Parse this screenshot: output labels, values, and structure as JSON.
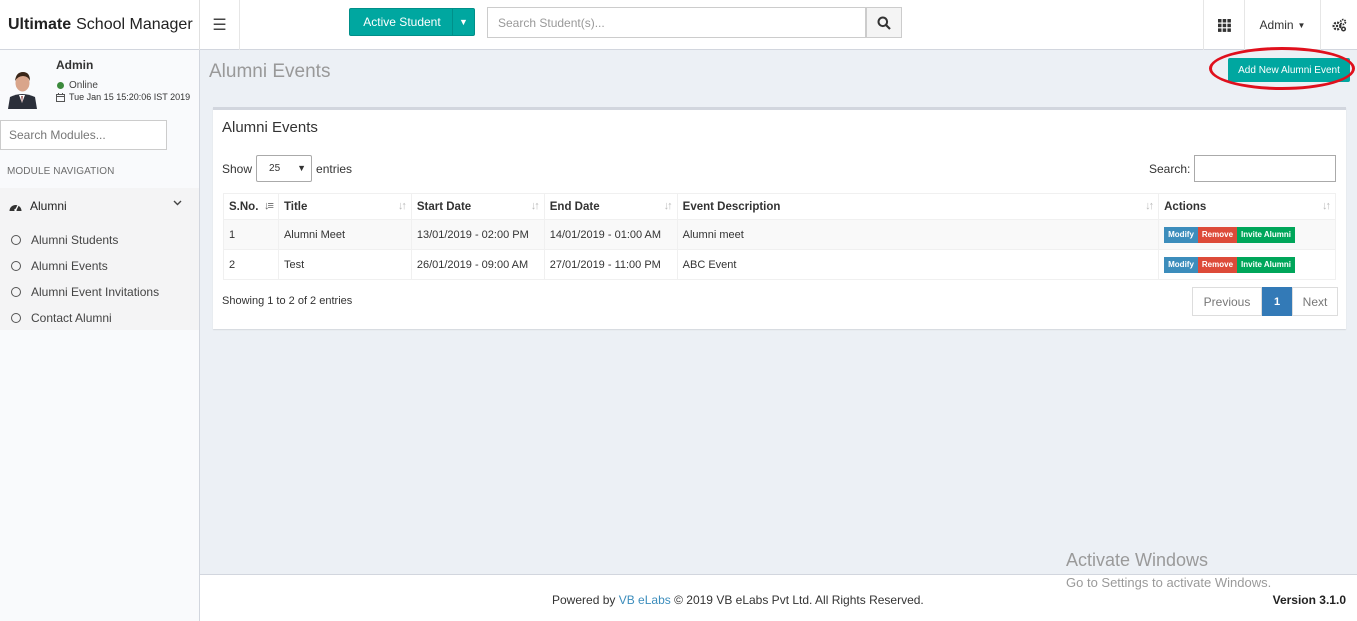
{
  "app": {
    "brand_bold": "Ultimate",
    "brand_rest": "School Manager"
  },
  "header": {
    "active_student_label": "Active Student",
    "search_placeholder": "Search Student(s)...",
    "admin_label": "Admin"
  },
  "sidebar": {
    "user_name": "Admin",
    "status": "Online",
    "datetime": "Tue Jan 15 15:20:06 IST 2019",
    "module_search_placeholder": "Search Modules...",
    "nav_header": "MODULE NAVIGATION",
    "group_label": "Alumni",
    "items": [
      {
        "label": "Alumni Students"
      },
      {
        "label": "Alumni Events"
      },
      {
        "label": "Alumni Event Invitations"
      },
      {
        "label": "Contact Alumni"
      }
    ]
  },
  "page": {
    "title": "Alumni Events",
    "add_button": "Add New Alumni Event"
  },
  "box": {
    "title": "Alumni Events",
    "show_label": "Show",
    "entries_value": "25",
    "entries_label": "entries",
    "search_label": "Search:",
    "columns": [
      "S.No.",
      "Title",
      "Start Date",
      "End Date",
      "Event Description",
      "Actions"
    ],
    "rows": [
      {
        "sno": "1",
        "title": "Alumni Meet",
        "start": "13/01/2019 - 02:00 PM",
        "end": "14/01/2019 - 01:00 AM",
        "desc": "Alumni meet"
      },
      {
        "sno": "2",
        "title": "Test",
        "start": "26/01/2019 - 09:00 AM",
        "end": "27/01/2019 - 11:00 PM",
        "desc": "ABC Event"
      }
    ],
    "actions": {
      "modify": "Modify",
      "remove": "Remove",
      "invite": "Invite Alumni"
    },
    "info": "Showing 1 to 2 of 2 entries",
    "pager": {
      "prev": "Previous",
      "current": "1",
      "next": "Next"
    }
  },
  "footer": {
    "powered": "Powered by",
    "link": "VB eLabs",
    "copyright": "© 2019 VB eLabs Pvt Ltd. All Rights Reserved.",
    "version": "Version 3.1.0"
  },
  "watermark": {
    "line1": "Activate Windows",
    "line2": "Go to Settings to activate Windows."
  },
  "colors": {
    "accent": "#00a7a0",
    "modify": "#3c8dbc",
    "remove": "#dd4b39",
    "invite": "#00a65a",
    "highlight_ring": "#e0101d"
  }
}
